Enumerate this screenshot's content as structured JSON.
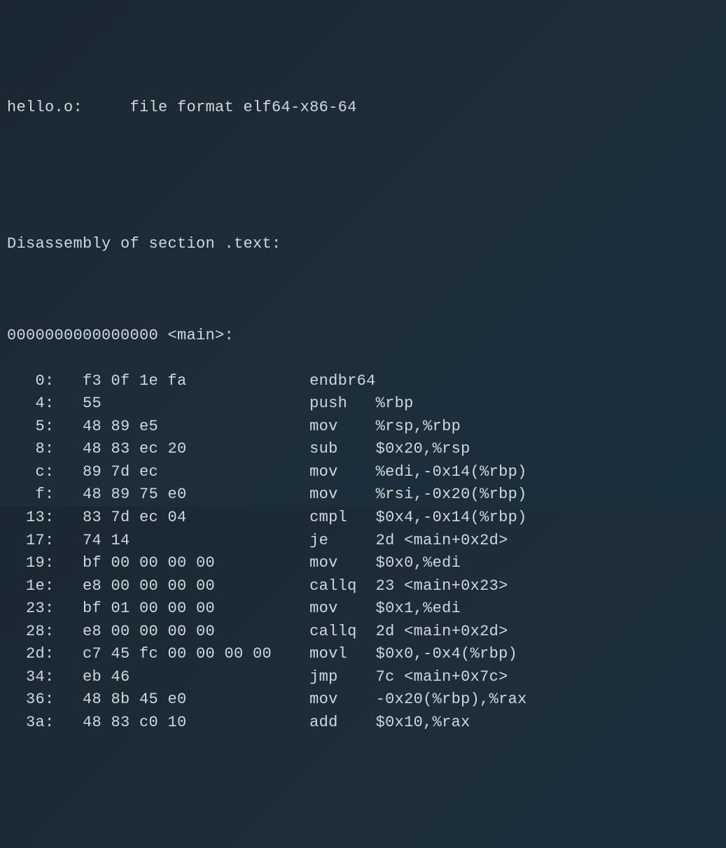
{
  "header": {
    "file_line": "hello.o:     file format elf64-x86-64",
    "section_line": "Disassembly of section .text:",
    "symbol_line": "0000000000000000 <main>:"
  },
  "instructions": [
    {
      "offset": "0",
      "bytes": "f3 0f 1e fa",
      "mnemonic": "endbr64",
      "operands": ""
    },
    {
      "offset": "4",
      "bytes": "55",
      "mnemonic": "push",
      "operands": "%rbp"
    },
    {
      "offset": "5",
      "bytes": "48 89 e5",
      "mnemonic": "mov",
      "operands": "%rsp,%rbp"
    },
    {
      "offset": "8",
      "bytes": "48 83 ec 20",
      "mnemonic": "sub",
      "operands": "$0x20,%rsp"
    },
    {
      "offset": "c",
      "bytes": "89 7d ec",
      "mnemonic": "mov",
      "operands": "%edi,-0x14(%rbp)"
    },
    {
      "offset": "f",
      "bytes": "48 89 75 e0",
      "mnemonic": "mov",
      "operands": "%rsi,-0x20(%rbp)"
    },
    {
      "offset": "13",
      "bytes": "83 7d ec 04",
      "mnemonic": "cmpl",
      "operands": "$0x4,-0x14(%rbp)"
    },
    {
      "offset": "17",
      "bytes": "74 14",
      "mnemonic": "je",
      "operands": "2d <main+0x2d>"
    },
    {
      "offset": "19",
      "bytes": "bf 00 00 00 00",
      "mnemonic": "mov",
      "operands": "$0x0,%edi"
    },
    {
      "offset": "1e",
      "bytes": "e8 00 00 00 00",
      "mnemonic": "callq",
      "operands": "23 <main+0x23>"
    },
    {
      "offset": "23",
      "bytes": "bf 01 00 00 00",
      "mnemonic": "mov",
      "operands": "$0x1,%edi"
    },
    {
      "offset": "28",
      "bytes": "e8 00 00 00 00",
      "mnemonic": "callq",
      "operands": "2d <main+0x2d>"
    },
    {
      "offset": "2d",
      "bytes": "c7 45 fc 00 00 00 00",
      "mnemonic": "movl",
      "operands": "$0x0,-0x4(%rbp)"
    },
    {
      "offset": "34",
      "bytes": "eb 46",
      "mnemonic": "jmp",
      "operands": "7c <main+0x7c>"
    },
    {
      "offset": "36",
      "bytes": "48 8b 45 e0",
      "mnemonic": "mov",
      "operands": "-0x20(%rbp),%rax"
    },
    {
      "offset": "3a",
      "bytes": "48 83 c0 10",
      "mnemonic": "add",
      "operands": "$0x10,%rax"
    }
  ]
}
